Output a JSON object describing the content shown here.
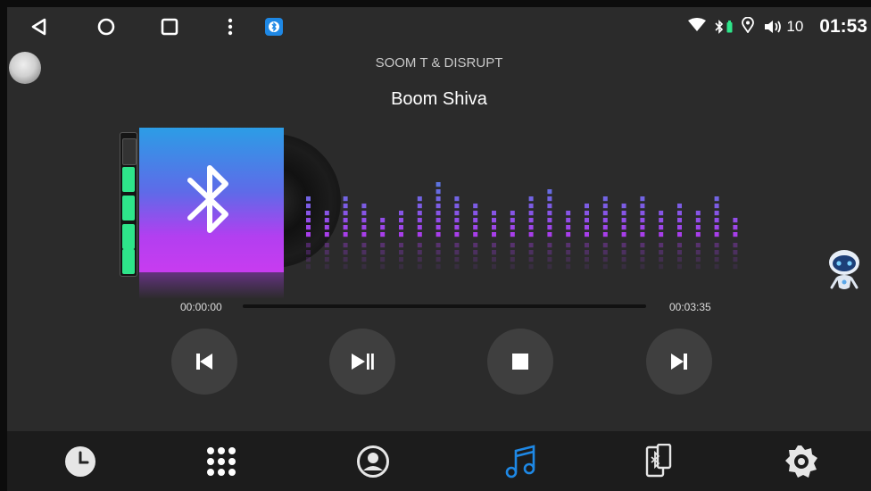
{
  "status_bar": {
    "volume": "10",
    "time": "01:53",
    "icons": [
      "back-icon",
      "home-icon",
      "recents-icon",
      "more-icon",
      "bluetooth-app-icon",
      "wifi-icon",
      "bluetooth-icon",
      "battery-icon",
      "location-icon",
      "volume-icon"
    ]
  },
  "track": {
    "artist": "SOOM T & DISRUPT",
    "title": "Boom Shiva",
    "elapsed": "00:00:00",
    "duration": "00:03:35",
    "progress": 0.0
  },
  "level_meter": {
    "level": 0.8
  },
  "controls": [
    "previous-icon",
    "play-pause-icon",
    "stop-icon",
    "next-icon"
  ],
  "bottom_tabs": [
    "clock-icon",
    "apps-grid-icon",
    "contacts-icon",
    "music-icon",
    "phone-bluetooth-icon",
    "settings-icon"
  ],
  "colors": {
    "background": "#2b2b2b",
    "accent": "#1e88e5",
    "meter_green": "#2ee58a",
    "art_top": "#2c9de6",
    "art_bottom": "#c83cf0"
  },
  "visualizer_levels": [
    6,
    4,
    6,
    5,
    3,
    4,
    6,
    8,
    6,
    5,
    4,
    4,
    6,
    7,
    4,
    5,
    6,
    5,
    6,
    4,
    5,
    4,
    6,
    3,
    5
  ]
}
